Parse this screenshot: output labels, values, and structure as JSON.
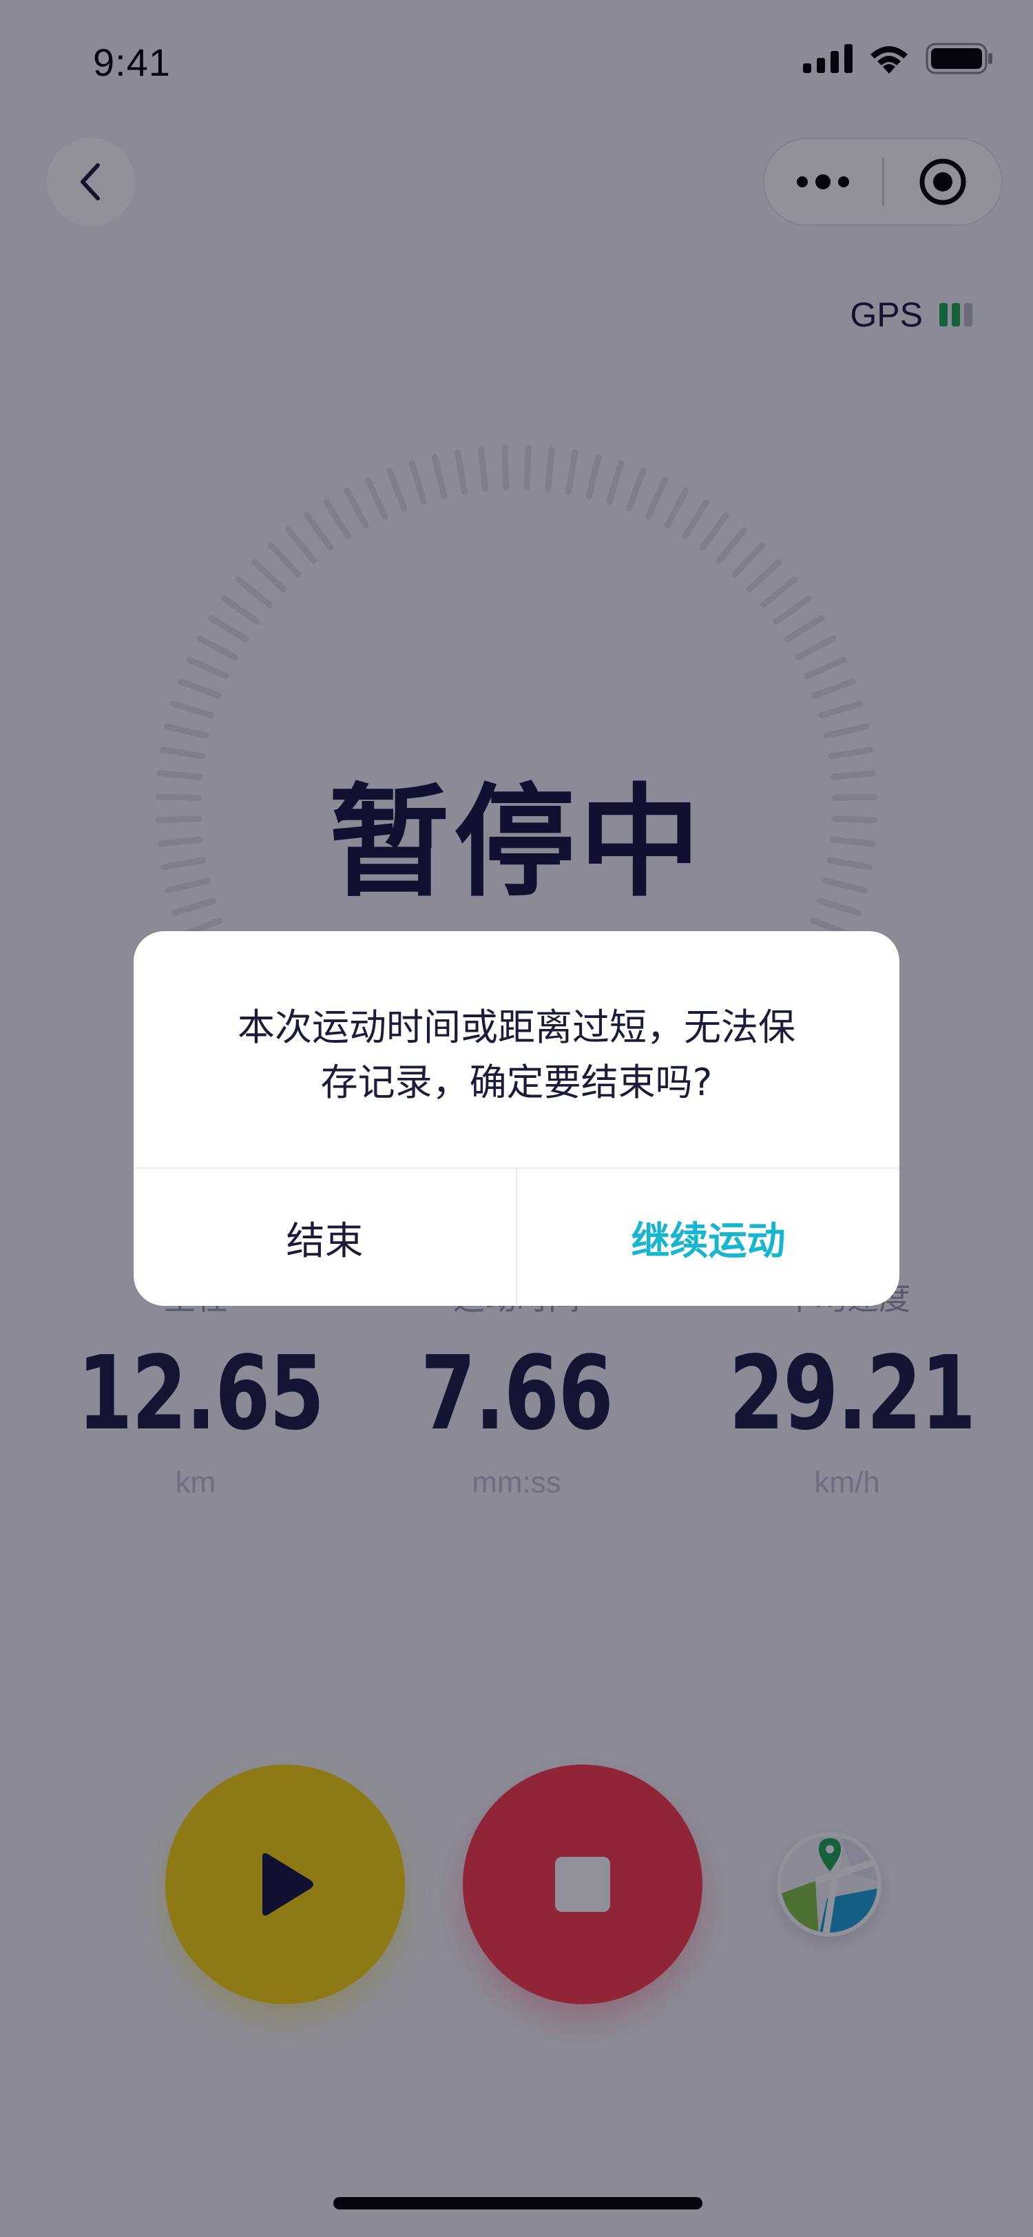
{
  "status_bar": {
    "time": "9:41"
  },
  "header": {
    "gps_label": "GPS",
    "gps_signal_level": 2,
    "gps_signal_max": 3
  },
  "main": {
    "status_title": "暂停中"
  },
  "stats": [
    {
      "label": "里程",
      "value": "12.65",
      "unit": "km"
    },
    {
      "label": "运动时间",
      "value": "7.66",
      "unit": "mm:ss"
    },
    {
      "label": "平均速度",
      "value": "29.21",
      "unit": "km/h"
    }
  ],
  "icons": {
    "back": "chevron-left-icon",
    "more": "more-dots-icon",
    "record": "target-icon",
    "resume": "play-icon",
    "stop": "stop-icon",
    "map": "map-pin-icon"
  },
  "colors": {
    "resume_button": "#f7d60a",
    "stop_button": "#ff3b4a",
    "accent": "#17b6cf",
    "gps_active": "#1fa84f",
    "gps_inactive": "#b8b8c0"
  },
  "dialog": {
    "message_line1": "本次运动时间或距离过短，无法保",
    "message_line2": "存记录，确定要结束吗?",
    "end_label": "结束",
    "continue_label": "继续运动"
  }
}
